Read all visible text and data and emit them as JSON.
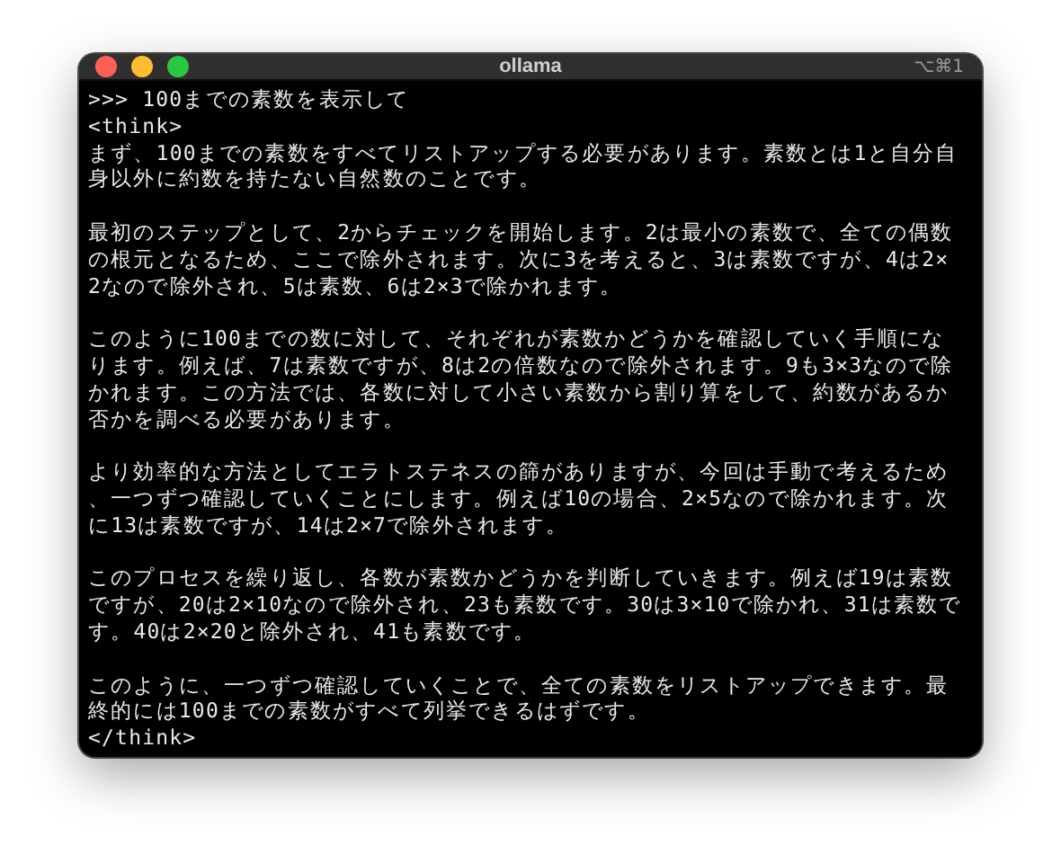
{
  "window": {
    "title": "ollama",
    "shortcut": "⌥⌘1"
  },
  "terminal": {
    "paragraphs": [
      [
        ">>> 100までの素数を表示して",
        "<think>",
        "まず、100までの素数をすべてリストアップする必要があります。素数とは1と自分自",
        "身以外に約数を持たない自然数のことです。"
      ],
      [
        "最初のステップとして、2からチェックを開始します。2は最小の素数で、全ての偶数",
        "の根元となるため、ここで除外されます。次に3を考えると、3は素数ですが、4は2×",
        "2なので除外され、5は素数、6は2×3で除かれます。"
      ],
      [
        "このように100までの数に対して、それぞれが素数かどうかを確認していく手順にな",
        "ります。例えば、7は素数ですが、8は2の倍数なので除外されます。9も3×3なので除",
        "かれます。この方法では、各数に対して小さい素数から割り算をして、約数があるか",
        "否かを調べる必要があります。"
      ],
      [
        "より効率的な方法としてエラトステネスの篩がありますが、今回は手動で考えるため",
        "、一つずつ確認していくことにします。例えば10の場合、2×5なので除かれます。次",
        "に13は素数ですが、14は2×7で除外されます。"
      ],
      [
        "このプロセスを繰り返し、各数が素数かどうかを判断していきます。例えば19は素数",
        "ですが、20は2×10なので除外され、23も素数です。30は3×10で除かれ、31は素数で",
        "す。40は2×20と除外され、41も素数です。"
      ],
      [
        "このように、一つずつ確認していくことで、全ての素数をリストアップできます。最",
        "終的には100までの素数がすべて列挙できるはずです。",
        "</think>"
      ]
    ]
  }
}
